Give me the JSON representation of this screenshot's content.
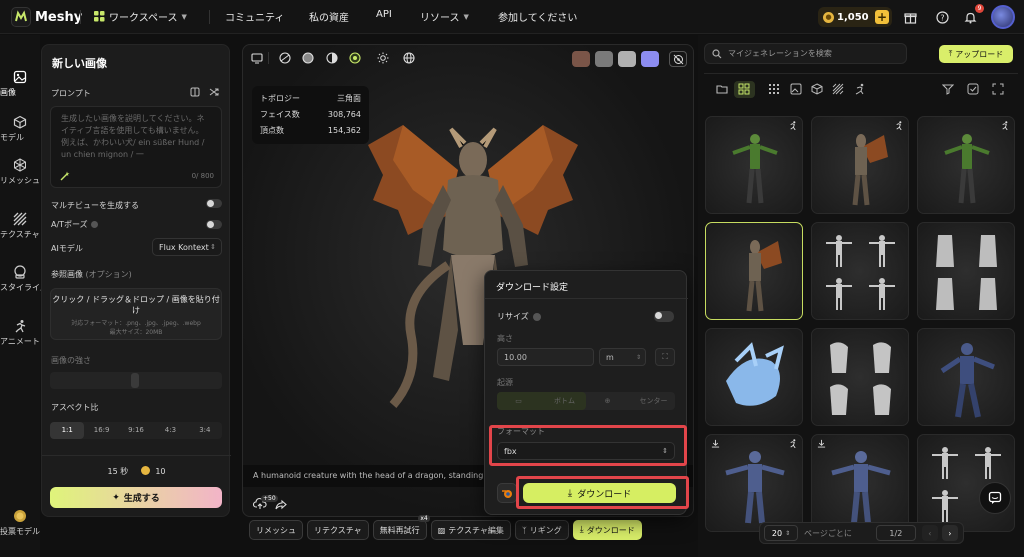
{
  "header": {
    "brand": "Meshy",
    "nav": [
      "ワークスペース",
      "コミュニティ",
      "私の資産",
      "API",
      "リソース",
      "参加してください"
    ],
    "credits": "1,050",
    "notification_count": "9"
  },
  "sidebar": {
    "items": [
      {
        "label": "画像"
      },
      {
        "label": "モデル"
      },
      {
        "label": "リメッシュ"
      },
      {
        "label": "テクスチャ"
      },
      {
        "label": "スタイライズ"
      },
      {
        "label": "アニメート"
      }
    ],
    "footer_label": "投票モデル"
  },
  "left_panel": {
    "title": "新しい画像",
    "prompt_label": "プロンプト",
    "prompt_placeholder": "生成したい画像を説明してください。ネイティブ言語を使用しても構いません。例えば、かわいい犬/ ein süßer Hund / un chien mignon / 一",
    "prompt_counter": "0/ 800",
    "multiview_label": "マルチビューを生成する",
    "apose_label": "A/Tポーズ",
    "ai_model_label": "AIモデル",
    "ai_model_value": "Flux Kontext",
    "reference_label": "参照画像",
    "reference_optional": "(オプション)",
    "dropzone_main": "クリック / ドラッグ＆ドロップ / 画像を貼り付け",
    "dropzone_formats": "対応フォーマット：.png、.jpg、.jpeg、.webp",
    "dropzone_maxsize": "最大サイズ：20MB",
    "strength_label": "画像の強さ",
    "aspect_label": "アスペクト比",
    "aspect_options": [
      "1:1",
      "16:9",
      "9:16",
      "4:3",
      "3:4"
    ],
    "aspect_selected": "1:1",
    "time_estimate": "15 秒",
    "cost": "10",
    "generate_button": "生成する"
  },
  "viewer": {
    "stats": [
      {
        "label": "トポロジー",
        "value": "三角面"
      },
      {
        "label": "フェイス数",
        "value": "308,764"
      },
      {
        "label": "頂点数",
        "value": "154,362"
      }
    ],
    "caption": "A humanoid creature with the head of a dragon, standing ta",
    "upload_badge": "+50",
    "actions": [
      "リメッシュ",
      "リテクスチャ",
      "無料再試行",
      "テクスチャ編集",
      "リギング",
      "ダウンロード"
    ],
    "retry_badge": "x4",
    "swatch_colors": [
      "#7a5548",
      "#7a7a7a",
      "#b0b0b0",
      "#8c8cf0"
    ]
  },
  "download_panel": {
    "title": "ダウンロード設定",
    "resize_label": "リサイズ",
    "height_label": "高さ",
    "height_value": "10.00",
    "unit_value": "m",
    "origin_label": "起源",
    "origin_options": [
      "ボトム",
      "センター"
    ],
    "format_label": "フォーマット",
    "format_value": "fbx",
    "download_button": "ダウンロード"
  },
  "gallery": {
    "search_placeholder": "マイジェネレーションを検索",
    "upload_button": "アップロード",
    "page_size": "20",
    "per_page_label": "ページごとに",
    "page_indicator": "1/2"
  }
}
